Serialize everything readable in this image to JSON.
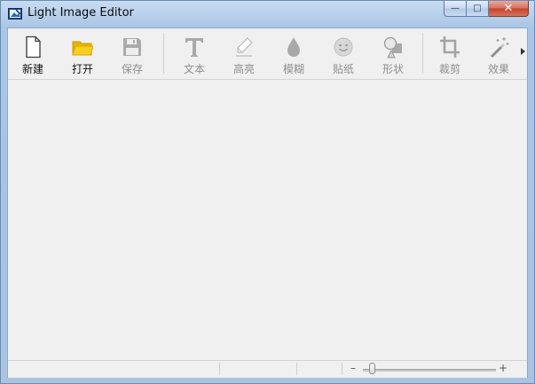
{
  "window": {
    "title": "Light Image Editor",
    "controls": {
      "minimize": "—",
      "maximize": "□",
      "close": "✕"
    }
  },
  "toolbar": {
    "items": [
      {
        "id": "new",
        "label": "新建",
        "icon": "new-document-icon",
        "enabled": true
      },
      {
        "id": "open",
        "label": "打开",
        "icon": "folder-open-icon",
        "enabled": true
      },
      {
        "id": "save",
        "label": "保存",
        "icon": "save-disk-icon",
        "enabled": false
      },
      {
        "id": "text",
        "label": "文本",
        "icon": "text-t-icon",
        "enabled": false
      },
      {
        "id": "highlight",
        "label": "高亮",
        "icon": "highlighter-pen-icon",
        "enabled": false
      },
      {
        "id": "blur",
        "label": "模糊",
        "icon": "blur-drop-icon",
        "enabled": false
      },
      {
        "id": "sticker",
        "label": "贴纸",
        "icon": "smiley-sticker-icon",
        "enabled": false
      },
      {
        "id": "shape",
        "label": "形状",
        "icon": "shapes-icon",
        "enabled": false
      },
      {
        "id": "crop",
        "label": "裁剪",
        "icon": "crop-icon",
        "enabled": false
      },
      {
        "id": "effects",
        "label": "效果",
        "icon": "magic-wand-icon",
        "enabled": false
      }
    ],
    "overflow_icon": "chevron-right-icon"
  },
  "statusbar": {
    "zoom": {
      "minus": "–",
      "plus": "+",
      "level": 0.05
    }
  },
  "colors": {
    "folder": "#f5c400",
    "disabled_icon": "#a9a9a9",
    "enabled_icon": "#3a3a3a"
  }
}
